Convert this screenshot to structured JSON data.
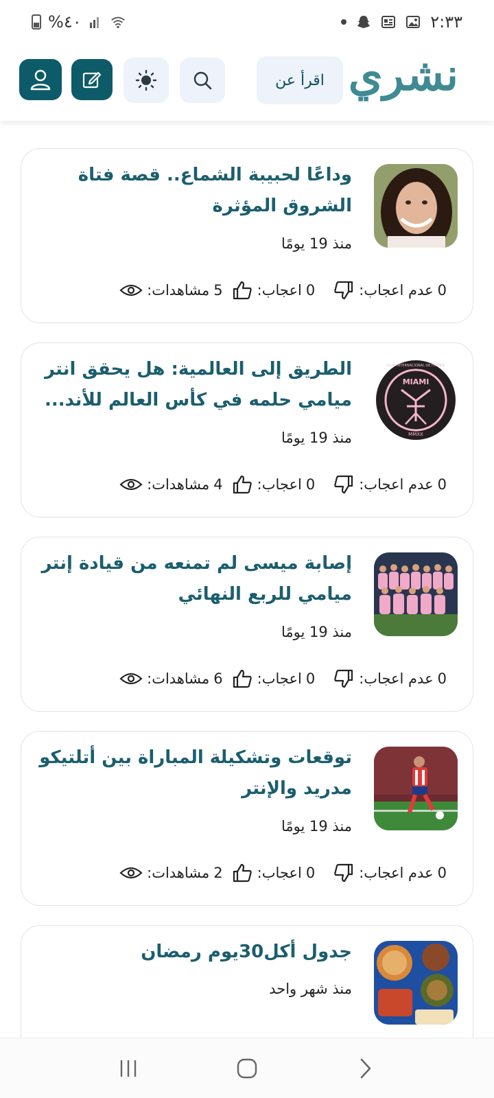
{
  "status_bar": {
    "battery_text": "%٤٠",
    "time": "٢:٣٣"
  },
  "header": {
    "logo": "نشري",
    "about_label": "اقرأ عن"
  },
  "labels": {
    "views": "مشاهدات:",
    "likes": "اعجاب:",
    "dislikes": "عدم اعجاب:"
  },
  "posts": [
    {
      "title": "وداعًا لحبيبة الشماع.. قصة فتاة الشروق المؤثرة",
      "time": "منذ 19 يومًا",
      "views": "5",
      "likes": "0",
      "dislikes": "0"
    },
    {
      "title": "الطريق إلى العالمية: هل يحقق انتر ميامي حلمه في كأس العالم للأند...",
      "time": "منذ 19 يومًا",
      "views": "4",
      "likes": "0",
      "dislikes": "0",
      "logo_text": "MIAMI",
      "logo_ring": "CLUB INTERNACIONAL DE FÚTBOL",
      "logo_year": "MMXX"
    },
    {
      "title": "إصابة ميسى لم تمنعه من قيادة إنتر ميامي للربع النهائي",
      "time": "منذ 19 يومًا",
      "views": "6",
      "likes": "0",
      "dislikes": "0"
    },
    {
      "title": "توقعات وتشكيلة المباراة بين أتلتيكو مدريد والإنتر",
      "time": "منذ 19 يومًا",
      "views": "2",
      "likes": "0",
      "dislikes": "0"
    },
    {
      "title": "جدول أكل30يوم رمضان",
      "time": "منذ شهر واحد"
    }
  ],
  "colors": {
    "brand_dark": "#0d5b68",
    "title": "#1b5e6e",
    "logo": "#3f8a93"
  }
}
